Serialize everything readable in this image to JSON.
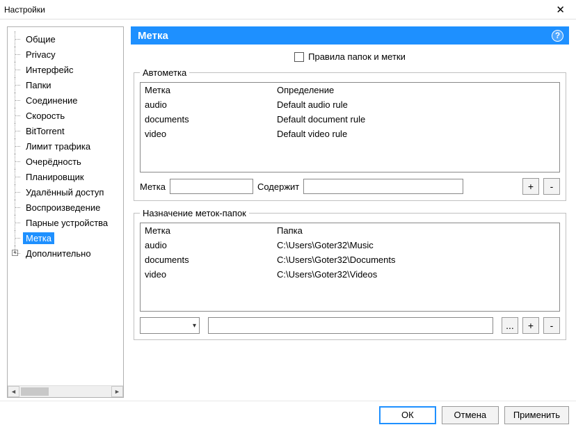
{
  "window": {
    "title": "Настройки"
  },
  "tree": {
    "items": [
      {
        "label": "Общие"
      },
      {
        "label": "Privacy"
      },
      {
        "label": "Интерфейс"
      },
      {
        "label": "Папки"
      },
      {
        "label": "Соединение"
      },
      {
        "label": "Скорость"
      },
      {
        "label": "BitTorrent"
      },
      {
        "label": "Лимит трафика"
      },
      {
        "label": "Очерёдность"
      },
      {
        "label": "Планировщик"
      },
      {
        "label": "Удалённый доступ"
      },
      {
        "label": "Воспроизведение"
      },
      {
        "label": "Парные устройства"
      },
      {
        "label": "Метка"
      },
      {
        "label": "Дополнительно"
      }
    ],
    "selected_index": 13,
    "expandable_index": 14
  },
  "pane": {
    "title": "Метка",
    "checkbox_label": "Правила папок и метки",
    "group1": {
      "legend": "Автометка",
      "col1_header": "Метка",
      "col2_header": "Определение",
      "rows": [
        {
          "label": "audio",
          "value": "Default audio rule"
        },
        {
          "label": "documents",
          "value": "Default document rule"
        },
        {
          "label": "video",
          "value": "Default video rule"
        }
      ],
      "label_label": "Метка",
      "contains_label": "Содержит",
      "plus": "+",
      "minus": "-"
    },
    "group2": {
      "legend": "Назначение меток-папок",
      "col1_header": "Метка",
      "col2_header": "Папка",
      "rows": [
        {
          "label": "audio",
          "value": "C:\\Users\\Goter32\\Music"
        },
        {
          "label": "documents",
          "value": "C:\\Users\\Goter32\\Documents"
        },
        {
          "label": "video",
          "value": "C:\\Users\\Goter32\\Videos"
        }
      ],
      "browse": "...",
      "plus": "+",
      "minus": "-"
    }
  },
  "footer": {
    "ok": "ОК",
    "cancel": "Отмена",
    "apply": "Применить"
  }
}
